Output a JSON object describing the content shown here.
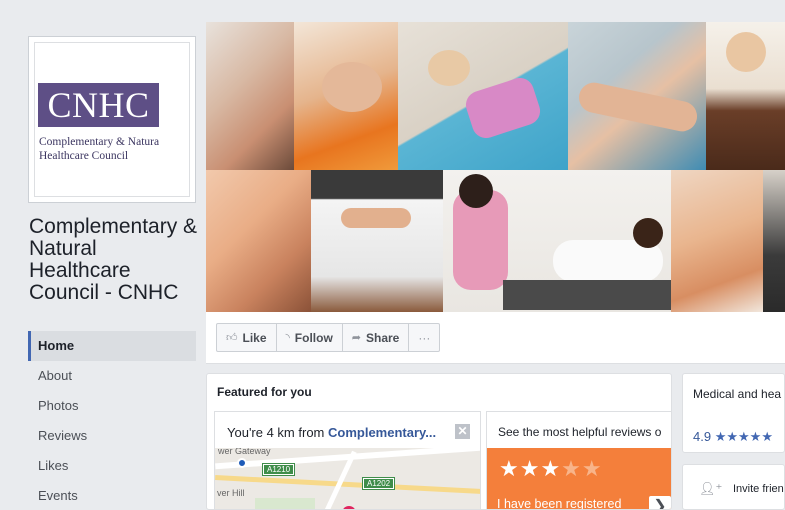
{
  "logo": {
    "mark": "CNHC",
    "line1": "Complementary & Natura",
    "line2": "Healthcare Council"
  },
  "page_name": "Complementary & Natural Healthcare Council - CNHC",
  "nav": [
    {
      "label": "Home",
      "active": true
    },
    {
      "label": "About"
    },
    {
      "label": "Photos"
    },
    {
      "label": "Reviews"
    },
    {
      "label": "Likes"
    },
    {
      "label": "Events"
    }
  ],
  "actions": {
    "like": "Like",
    "follow": "Follow",
    "share": "Share",
    "more": "···"
  },
  "featured": {
    "title": "Featured for you",
    "card1": {
      "prefix": "You're 4 km from ",
      "link": "Complementary...",
      "close": "✕",
      "map": {
        "label1": "wer Gateway",
        "label2": "ver Hill",
        "road1": "A1210",
        "road2": "A1202"
      }
    },
    "card2": {
      "heading": "See the most helpful reviews o",
      "stars_filled": "★★★",
      "stars_empty": "★★",
      "review_text": "I have been registered",
      "next": "❯"
    }
  },
  "info": {
    "category": "Medical and hea Kingdom",
    "rating": "4.9",
    "rating_stars": "★★★★★"
  },
  "invite": {
    "label": "Invite friend"
  },
  "colors": {
    "accent": "#4267b2",
    "logo_purple": "#5e4f86",
    "review_orange": "#f47f3b"
  }
}
